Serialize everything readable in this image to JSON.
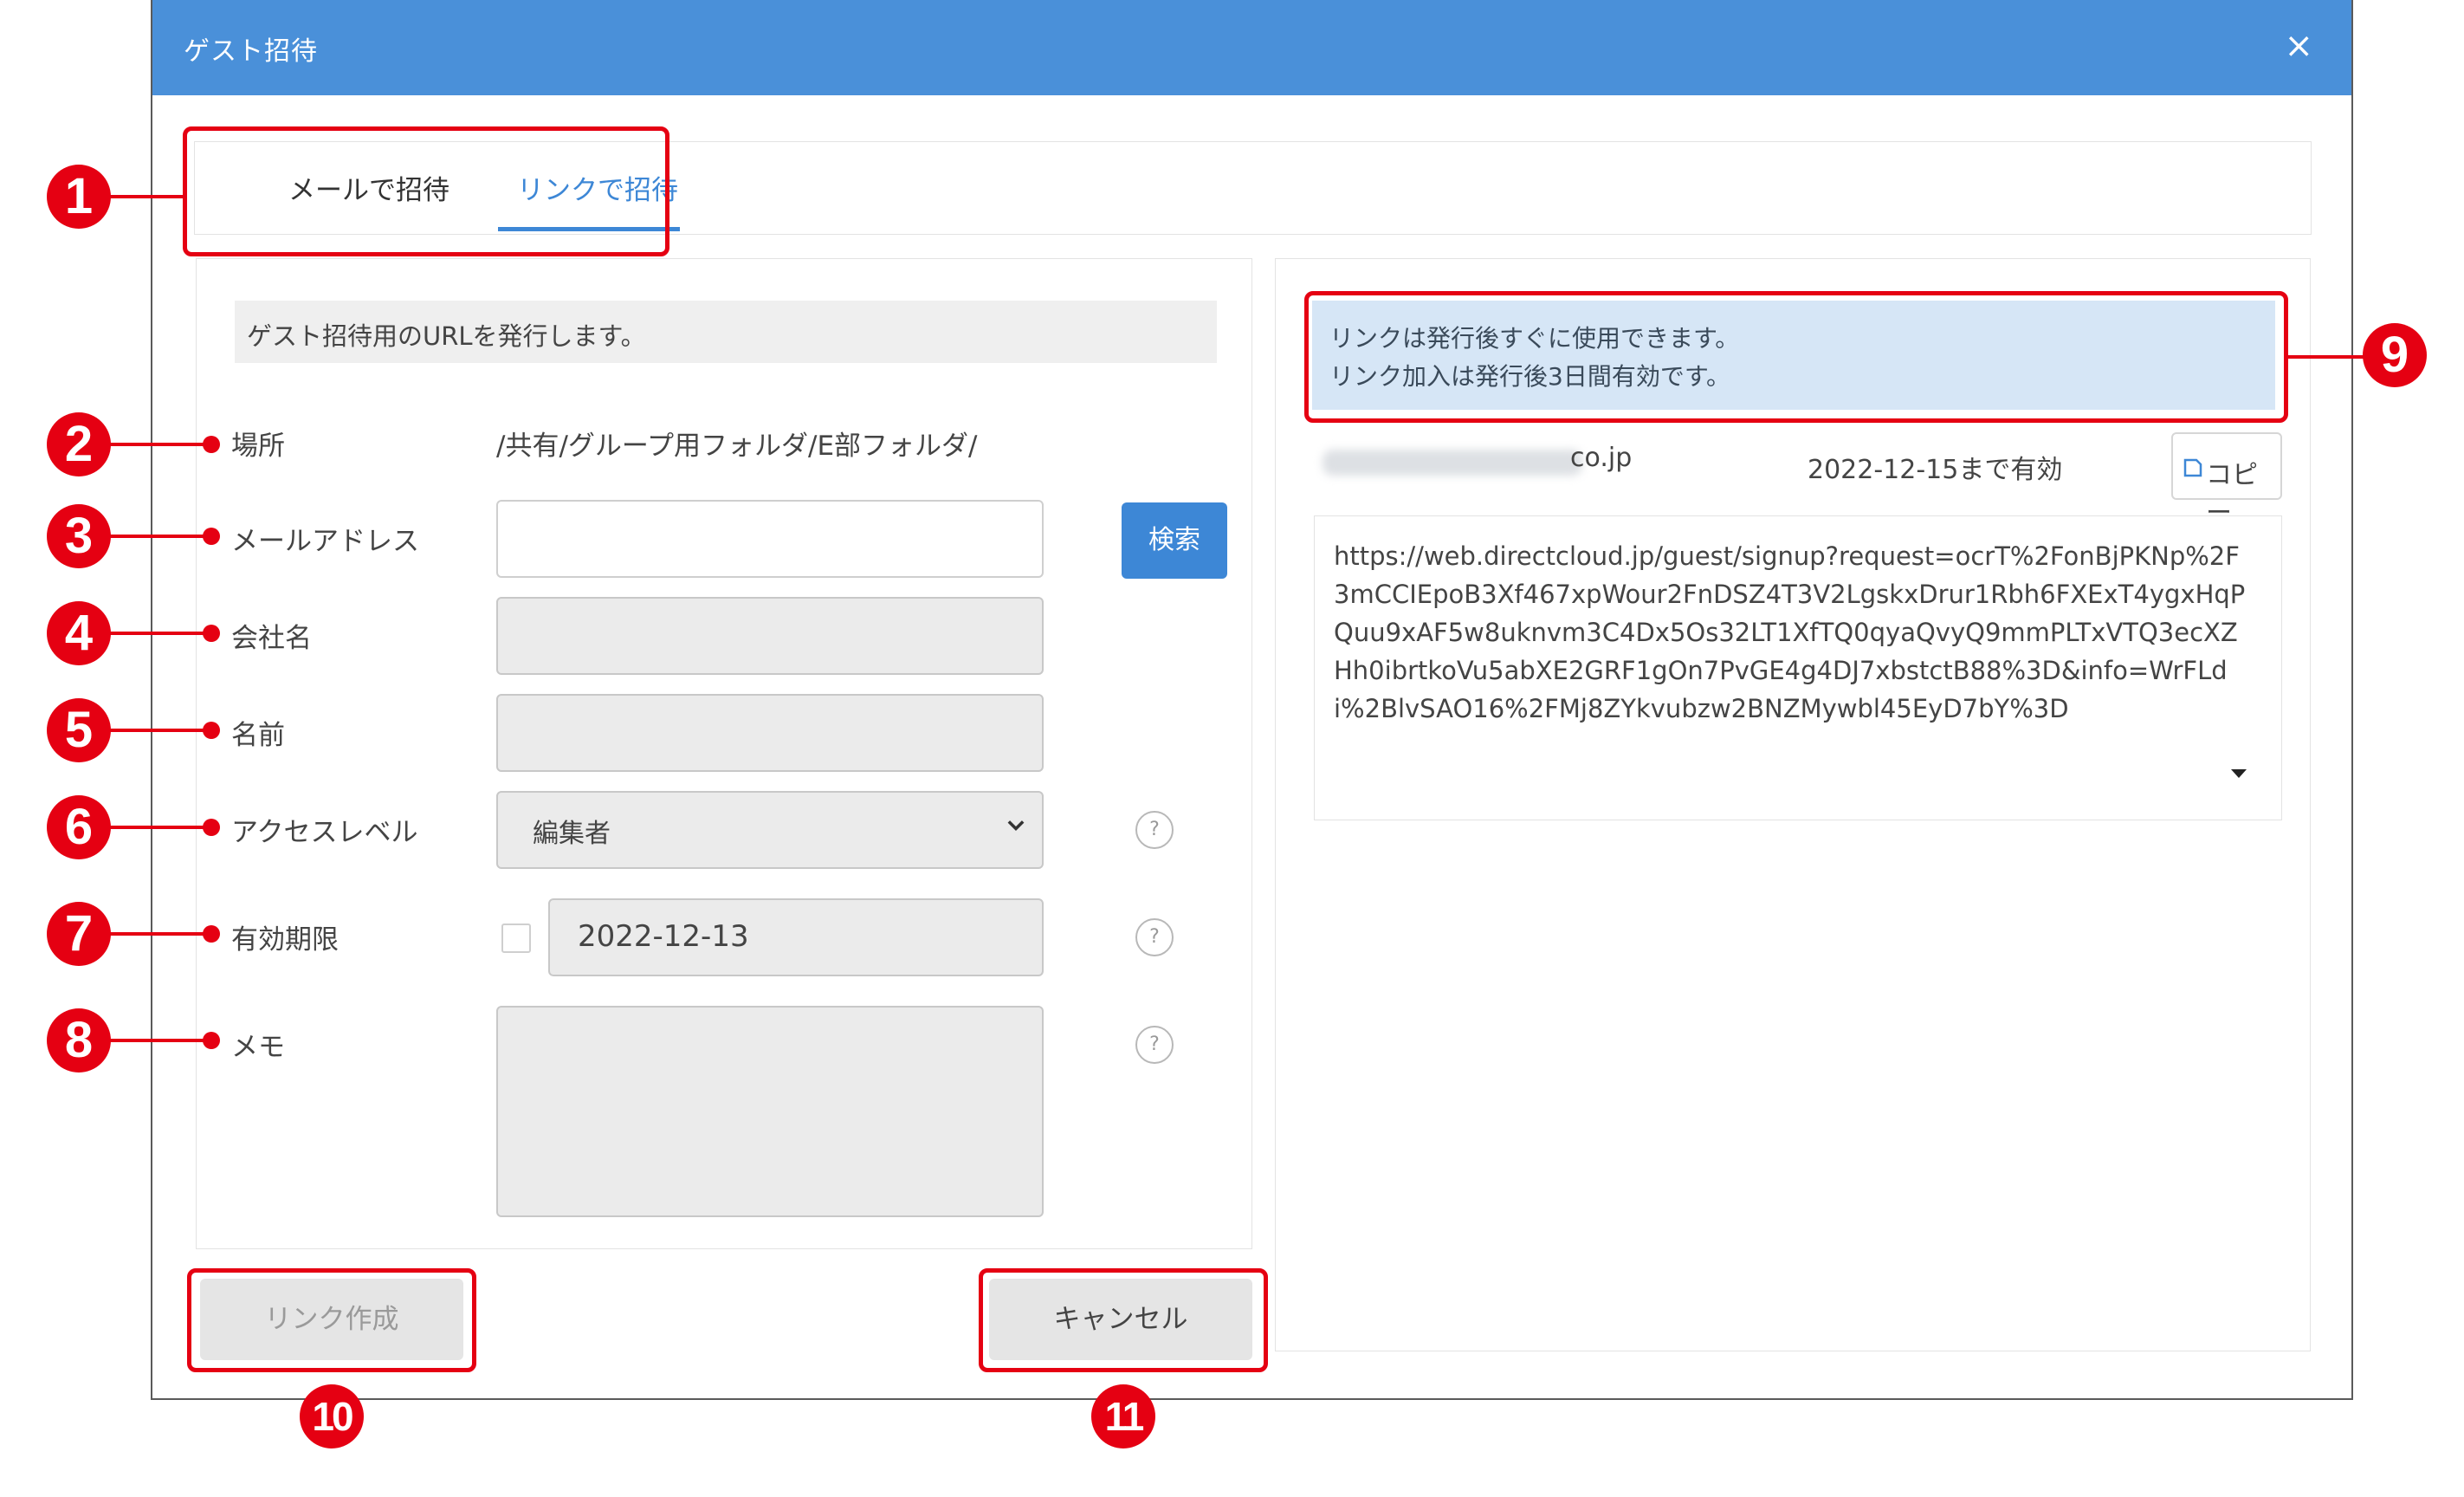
{
  "dialog": {
    "title": "ゲスト招待",
    "close_icon": "×"
  },
  "tabs": [
    {
      "label": "メールで招待",
      "active": false
    },
    {
      "label": "リンクで招待",
      "active": true
    }
  ],
  "left": {
    "info": "ゲスト招待用のURLを発行します。",
    "fields": {
      "location": {
        "label": "場所",
        "value": "/共有/グループ用フォルダ/E部フォルダ/"
      },
      "email": {
        "label": "メールアドレス",
        "value": "",
        "search_label": "検索"
      },
      "company": {
        "label": "会社名",
        "value": ""
      },
      "name": {
        "label": "名前",
        "value": ""
      },
      "access_level": {
        "label": "アクセスレベル",
        "selected": "編集者"
      },
      "expiry": {
        "label": "有効期限",
        "checked": false,
        "value": "2022-12-13"
      },
      "memo": {
        "label": "メモ",
        "value": ""
      }
    },
    "help_icon": "?"
  },
  "buttons": {
    "create": "リンク作成",
    "cancel": "キャンセル"
  },
  "right": {
    "notice_line1": "リンクは発行後すぐに使用できます。",
    "notice_line2": "リンク加入は発行後3日間有効です。",
    "email_domain": "co.jp",
    "valid_until": "2022-12-15まで有効",
    "copy_label": "コピー",
    "url_lines": [
      "https://web.directcloud.jp/guest/signup?request=ocrT%2FonBjPKNp%2F",
      "3mCCIEpoB3Xf467xpWour2FnDSZ4T3V2LgskxDrur1Rbh6FXExT4ygxHqP",
      "Quu9xAF5w8uknvm3C4Dx5Os32LT1XfTQ0qyaQvyQ9mmPLTxVTQ3ecXZ",
      "Hh0ibrtkoVu5abXE2GRF1gOn7PvGE4g4DJ7xbstctB88%3D&info=WrFLd",
      "i%2BlvSAO16%2FMj8ZYkvubzw2BNZMywbl45EyD7bY%3D"
    ]
  },
  "callouts": [
    "❶",
    "❷",
    "❸",
    "❹",
    "❺",
    "❻",
    "❼",
    "❽",
    "❾",
    "❿",
    "⓫"
  ],
  "callout_numbers": [
    "1",
    "2",
    "3",
    "4",
    "5",
    "6",
    "7",
    "8",
    "9",
    "10",
    "11"
  ],
  "colors": {
    "title_bar": "#4a90d9",
    "accent": "#3d87d6",
    "annotation_red": "#e50012",
    "notice_bg": "#d6e6f6"
  }
}
